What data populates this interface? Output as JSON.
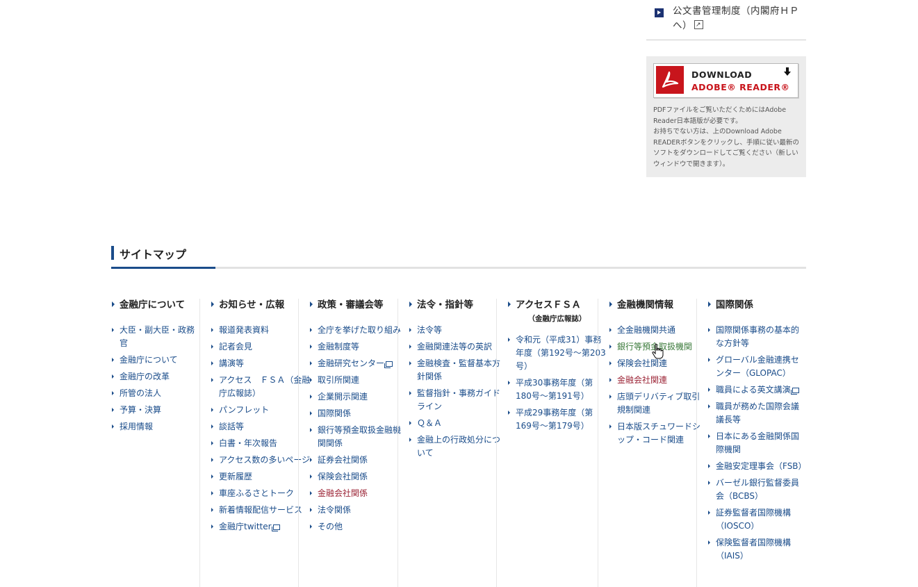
{
  "sidebar_link": {
    "label": "公文書管理制度（内閣府ＨＰへ）"
  },
  "adobe": {
    "line1": "DOWNLOAD",
    "line2_brand": "ADOBE",
    "line2_rest": "® READER®",
    "note": "PDFファイルをご覧いただくためにはAdobe Reader日本語版が必要です。\nお持ちでない方は、上のDownload Adobe READERボタンをクリックし、手順に従い最新のソフトをダウンロードしてご覧ください（新しいウィンドウで開きます）。"
  },
  "sitemap": {
    "title": "サイトマップ",
    "columns": [
      {
        "heading": "金融庁について",
        "sub": "",
        "items": [
          {
            "label": "大臣・副大臣・政務官"
          },
          {
            "label": "金融庁について"
          },
          {
            "label": "金融庁の改革"
          },
          {
            "label": "所管の法人"
          },
          {
            "label": "予算・決算"
          },
          {
            "label": "採用情報"
          }
        ]
      },
      {
        "heading": "お知らせ・広報",
        "sub": "",
        "items": [
          {
            "label": "報道発表資料"
          },
          {
            "label": "記者会見"
          },
          {
            "label": "講演等"
          },
          {
            "label": "アクセス　ＦＳＡ（金融庁広報誌）"
          },
          {
            "label": "パンフレット"
          },
          {
            "label": "談話等"
          },
          {
            "label": "白書・年次報告"
          },
          {
            "label": "アクセス数の多いページ"
          },
          {
            "label": "更新履歴"
          },
          {
            "label": "車座ふるさとトーク"
          },
          {
            "label": "新着情報配信サービス"
          },
          {
            "label": "金融庁twitter",
            "win": true
          }
        ]
      },
      {
        "heading": "政策・審議会等",
        "sub": "",
        "items": [
          {
            "label": "全庁を挙げた取り組み"
          },
          {
            "label": "金融制度等"
          },
          {
            "label": "金融研究センター",
            "win": true
          },
          {
            "label": "取引所関連"
          },
          {
            "label": "企業開示関連"
          },
          {
            "label": "国際関係"
          },
          {
            "label": "銀行等預金取扱金融機関関係"
          },
          {
            "label": "証券会社関係"
          },
          {
            "label": "保険会社関係"
          },
          {
            "label": "金融会社関係",
            "style": "red"
          },
          {
            "label": "法令関係"
          },
          {
            "label": "その他"
          }
        ]
      },
      {
        "heading": "法令・指針等",
        "sub": "",
        "items": [
          {
            "label": "法令等"
          },
          {
            "label": "金融関連法等の英訳"
          },
          {
            "label": "金融検査・監督基本方針関係"
          },
          {
            "label": "監督指針・事務ガイドライン"
          },
          {
            "label": "Ｑ＆Ａ"
          },
          {
            "label": "金融上の行政処分について"
          }
        ]
      },
      {
        "heading": "アクセスＦＳＡ",
        "sub": "（金融庁広報誌）",
        "items": [
          {
            "label": "令和元（平成31）事務年度（第192号～第203号）"
          },
          {
            "label": "平成30事務年度（第180号～第191号）"
          },
          {
            "label": "平成29事務年度（第169号～第179号）"
          }
        ]
      },
      {
        "heading": "金融機関情報",
        "sub": "",
        "items": [
          {
            "label": "全金融機関共通"
          },
          {
            "label": "銀行等預金取扱機関",
            "style": "green"
          },
          {
            "label": "保険会社関連"
          },
          {
            "label": "金融会社関連",
            "style": "red"
          },
          {
            "label": "店頭デリバティブ取引規制関連"
          },
          {
            "label": "日本版スチュワードシップ・コード関連"
          }
        ]
      },
      {
        "heading": "国際関係",
        "sub": "",
        "items": [
          {
            "label": "国際関係事務の基本的な方針等"
          },
          {
            "label": "グローバル金融連携センター（GLOPAC）"
          },
          {
            "label": "職員による英文講演",
            "win": true
          },
          {
            "label": "職員が務めた国際会議議長等"
          },
          {
            "label": "日本にある金融関係国際機関"
          },
          {
            "label": "金融安定理事会（FSB）"
          },
          {
            "label": "バーゼル銀行監督委員会（BCBS）"
          },
          {
            "label": "証券監督者国際機構（IOSCO）"
          },
          {
            "label": "保険監督者国際機構（IAIS）"
          }
        ]
      }
    ]
  }
}
